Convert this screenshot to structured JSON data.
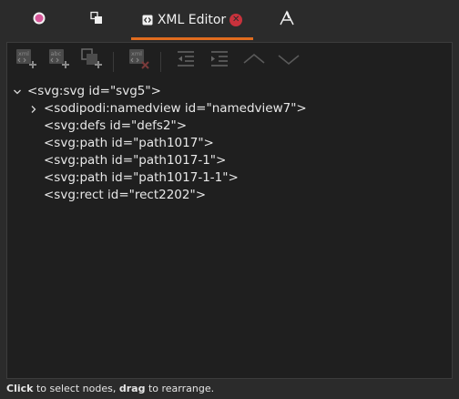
{
  "tabs": [
    {
      "name": "fill-stroke",
      "icon": "fill-stroke-icon"
    },
    {
      "name": "objects",
      "icon": "objects-icon"
    },
    {
      "name": "xml-editor",
      "icon": "xml-editor-icon",
      "label": "XML Editor",
      "active": true,
      "close_icon": "close-icon"
    },
    {
      "name": "text-font",
      "icon": "text-font-icon"
    }
  ],
  "toolbar": {
    "buttons": [
      {
        "name": "new-element-node",
        "icon": "new-element-node-icon",
        "enabled": false
      },
      {
        "name": "new-text-node",
        "icon": "new-text-node-icon",
        "enabled": false
      },
      {
        "name": "duplicate-node",
        "icon": "duplicate-node-icon",
        "enabled": false
      },
      {
        "name": "delete-node",
        "icon": "delete-node-icon",
        "enabled": false
      },
      {
        "name": "unindent-node",
        "icon": "unindent-node-icon",
        "enabled": false
      },
      {
        "name": "indent-node",
        "icon": "indent-node-icon",
        "enabled": false
      },
      {
        "name": "raise-node",
        "icon": "raise-node-icon",
        "enabled": false
      },
      {
        "name": "lower-node",
        "icon": "lower-node-icon",
        "enabled": false
      }
    ]
  },
  "tree": {
    "root": {
      "text": "<svg:svg id=\"svg5\">",
      "expanded": true
    },
    "children": [
      {
        "text": "<sodipodi:namedview id=\"namedview7\">",
        "expandable": true,
        "expanded": false
      },
      {
        "text": "<svg:defs id=\"defs2\">",
        "expandable": false
      },
      {
        "text": "<svg:path id=\"path1017\">",
        "expandable": false
      },
      {
        "text": "<svg:path id=\"path1017-1\">",
        "expandable": false
      },
      {
        "text": "<svg:path id=\"path1017-1-1\">",
        "expandable": false
      },
      {
        "text": "<svg:rect id=\"rect2202\">",
        "expandable": false
      }
    ]
  },
  "status": {
    "click": "Click",
    "click_rest": " to select nodes, ",
    "drag": "drag",
    "drag_rest": " to rearrange."
  },
  "colors": {
    "accent": "#e06c1f",
    "close": "#c8323c",
    "panel_bg": "#1f1f1f",
    "window_bg": "#2b2b2b"
  }
}
